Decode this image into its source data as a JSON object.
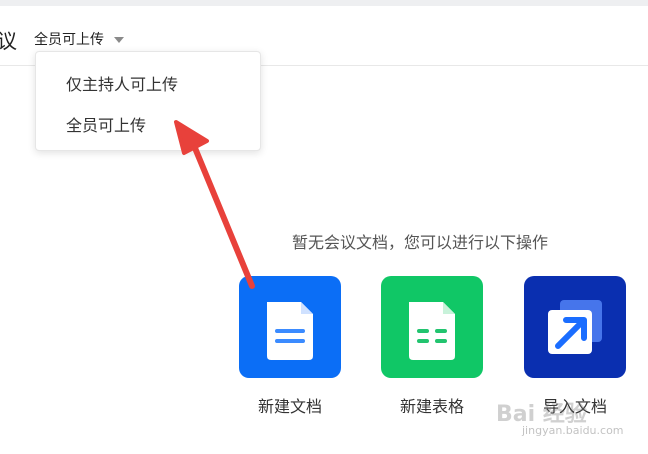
{
  "header": {
    "title_fragment": "议",
    "permission_selected": "全员可上传"
  },
  "dropdown": {
    "options": [
      "仅主持人可上传",
      "全员可上传"
    ]
  },
  "empty_state": {
    "message": "暂无会议文档，您可以进行以下操作"
  },
  "actions": [
    {
      "label": "新建文档",
      "icon": "document-icon",
      "color": "#0b6ef6"
    },
    {
      "label": "新建表格",
      "icon": "spreadsheet-icon",
      "color": "#10c766"
    },
    {
      "label": "导入文档",
      "icon": "import-icon",
      "color": "#0a2fb0"
    }
  ],
  "annotation": {
    "color": "#e8413b"
  },
  "watermark": {
    "brand": "Bai 经验",
    "url": "jingyan.baidu.com"
  }
}
